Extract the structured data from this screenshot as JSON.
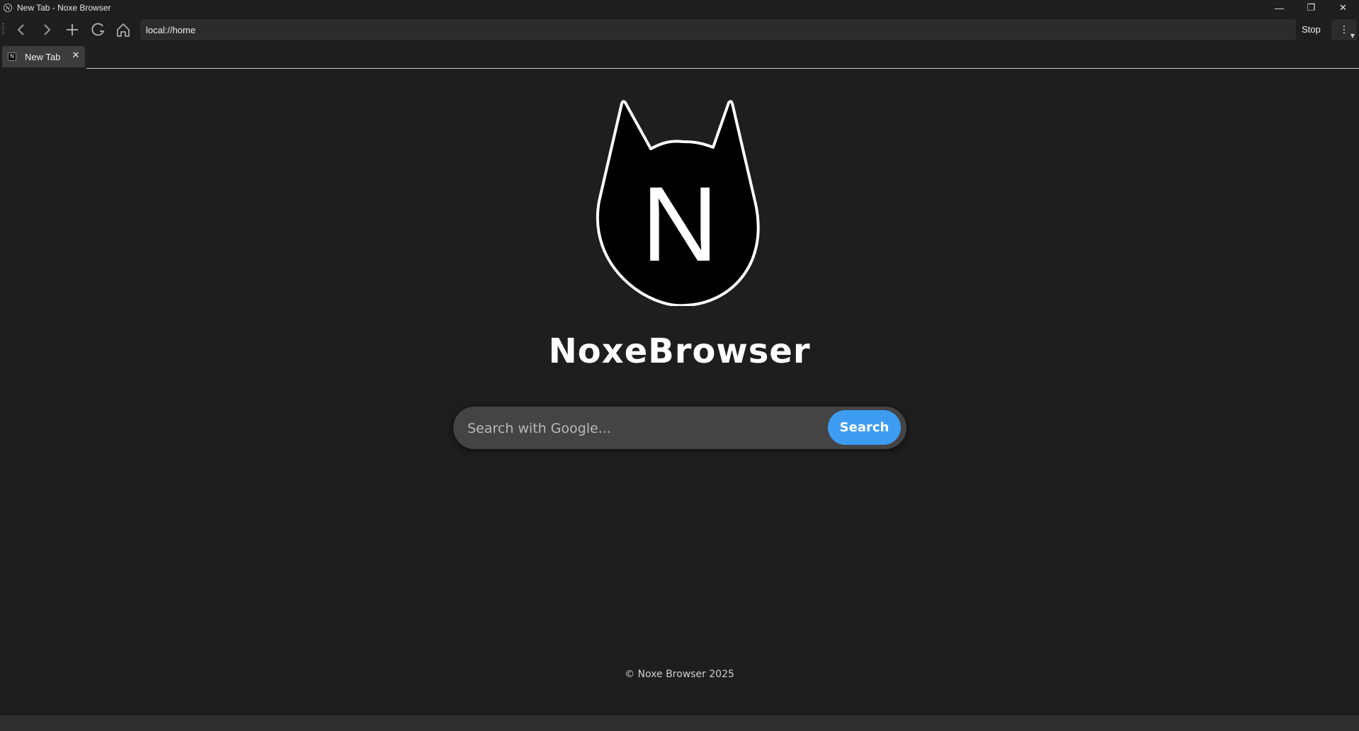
{
  "window": {
    "title": "New Tab - Noxe Browser",
    "app_icon_letter": "N",
    "controls": {
      "minimize": "—",
      "restore": "❐",
      "close": "✕"
    }
  },
  "toolbar": {
    "back_icon": "chevron-left-icon",
    "forward_icon": "chevron-right-icon",
    "new_tab_icon": "plus-icon",
    "reload_icon": "reload-icon",
    "home_icon": "home-icon",
    "address_value": "local://home",
    "stop_label": "Stop",
    "menu_label": "⋮"
  },
  "tabs": [
    {
      "label": "New Tab",
      "favicon_letter": "N",
      "close_label": "✕",
      "active": true
    }
  ],
  "page": {
    "logo_letter": "N",
    "brand_name": "NoxeBrowser",
    "search_placeholder": "Search with Google...",
    "search_button_label": "Search",
    "footer_text": "© Noxe Browser 2025"
  },
  "colors": {
    "background": "#1e1e1e",
    "search_field": "#444444",
    "search_button": "#3d9cf0",
    "address_bar": "#2c2c2c",
    "active_tab": "#3c3c3c"
  }
}
